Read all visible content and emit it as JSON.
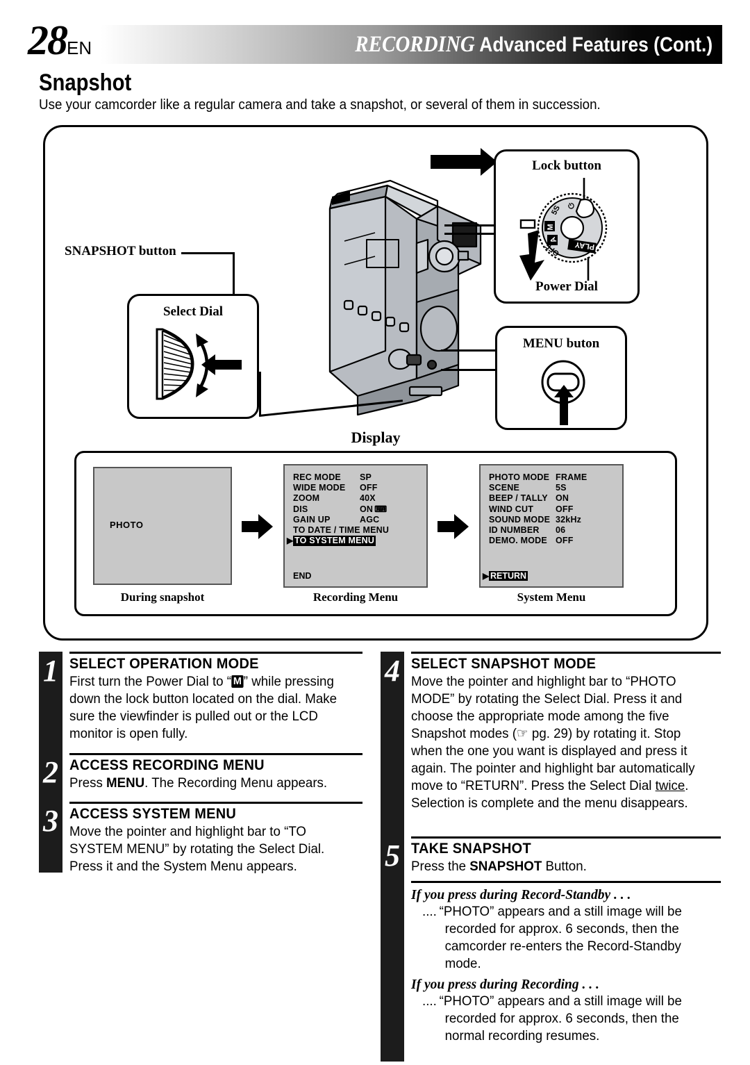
{
  "header": {
    "page_number": "28",
    "language_code": "EN",
    "title_italic": "RECORDING",
    "title_rest": "Advanced Features (Cont.)"
  },
  "section": {
    "title": "Snapshot",
    "intro": "Use your camcorder like a regular camera and take a snapshot, or several of them in succession."
  },
  "callouts": {
    "snapshot_button": "SNAPSHOT button",
    "lock_button": "Lock button",
    "power_dial": "Power Dial",
    "select_dial": "Select Dial",
    "menu_button": "MENU buton",
    "display": "Display"
  },
  "power_dial_positions": [
    "⏻",
    "5S",
    "M",
    "A",
    "OFF",
    "PLAY"
  ],
  "screens": {
    "during_snapshot": {
      "caption": "During snapshot",
      "osd_text": "PHOTO"
    },
    "recording_menu": {
      "caption": "Recording Menu",
      "rows": [
        {
          "label": "REC MODE",
          "value": "SP",
          "highlight": false,
          "pointer": false
        },
        {
          "label": "WIDE MODE",
          "value": "OFF",
          "highlight": false,
          "pointer": false
        },
        {
          "label": "ZOOM",
          "value": "40X",
          "highlight": false,
          "pointer": false
        },
        {
          "label": "DIS",
          "value": "ON",
          "icon": "hand-flag-icon",
          "highlight": false,
          "pointer": false
        },
        {
          "label": "GAIN UP",
          "value": "AGC",
          "highlight": false,
          "pointer": false
        },
        {
          "label": "TO DATE / TIME MENU",
          "value": "",
          "wide": true,
          "highlight": false,
          "pointer": false
        },
        {
          "label": "TO SYSTEM MENU",
          "value": "",
          "wide": true,
          "highlight": true,
          "pointer": true
        }
      ],
      "end_label": "END"
    },
    "system_menu": {
      "caption": "System Menu",
      "rows": [
        {
          "label": "PHOTO MODE",
          "value": "FRAME"
        },
        {
          "label": "SCENE",
          "value": "5S"
        },
        {
          "label": "BEEP / TALLY",
          "value": "ON"
        },
        {
          "label": "WIND CUT",
          "value": "OFF"
        },
        {
          "label": "SOUND MODE",
          "value": "32kHz"
        },
        {
          "label": "ID NUMBER",
          "value": "06"
        },
        {
          "label": "DEMO. MODE",
          "value": "OFF"
        }
      ],
      "return_label": "RETURN"
    }
  },
  "steps": [
    {
      "number": "1",
      "title": "SELECT OPERATION MODE",
      "text_a": "First turn the Power Dial to “",
      "badge": "M",
      "text_b": "” while pressing down the lock button located on the dial. Make sure the viewfinder is pulled out or the LCD monitor is open fully."
    },
    {
      "number": "2",
      "title": "ACCESS RECORDING MENU",
      "text_a": "Press ",
      "bold": "MENU",
      "text_b": ". The Recording Menu appears."
    },
    {
      "number": "3",
      "title": "ACCESS SYSTEM MENU",
      "text_a": "Move the pointer and highlight bar to “TO SYSTEM MENU” by rotating the Select Dial. Press it and the System Menu appears."
    },
    {
      "number": "4",
      "title": "SELECT SNAPSHOT MODE",
      "text_a": "Move the pointer and highlight bar to “PHOTO MODE” by rotating the Select Dial. Press it and choose the appropriate mode among the five Snapshot modes (",
      "ref_icon": "☞",
      "ref_text": " pg. 29",
      "text_b": ") by rotating it. Stop when the one you want is displayed and press it again. The pointer and highlight bar automatically move to “RETURN”. Press the Select Dial ",
      "underlined": "twice",
      "text_c": ". Selection is complete and the menu disappears."
    },
    {
      "number": "5",
      "title": "TAKE SNAPSHOT",
      "text_a": "Press the ",
      "bold": "SNAPSHOT",
      "text_b": " Button."
    }
  ],
  "notes": [
    {
      "title": "If you press during Record-Standby . . .",
      "dots": "....",
      "text": "“PHOTO” appears and a still image will be recorded for approx. 6 seconds, then the camcorder re-enters the Record-Standby mode."
    },
    {
      "title": "If you press during Recording . . .",
      "dots": "....",
      "text": "“PHOTO” appears and a still image will be recorded for approx. 6 seconds, then the normal recording resumes."
    }
  ]
}
